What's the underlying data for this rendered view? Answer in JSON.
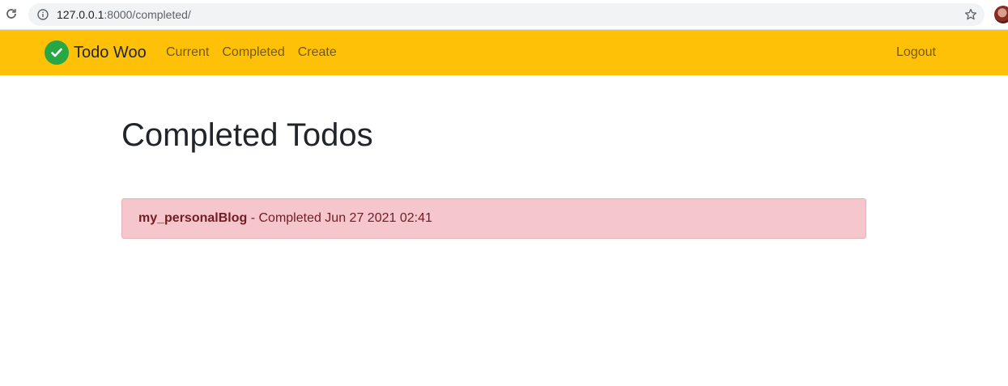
{
  "browser": {
    "url_host": "127.0.0.1",
    "url_rest": ":8000/completed/",
    "icons": {
      "reload": "reload-icon",
      "info": "info-icon",
      "bookmark": "star-icon"
    }
  },
  "navbar": {
    "background": "#ffc107",
    "brand": {
      "name": "Todo Woo",
      "logo_color": "#28a745",
      "logo_icon": "check-circle-icon"
    },
    "links": [
      {
        "label": "Current"
      },
      {
        "label": "Completed"
      },
      {
        "label": "Create"
      }
    ],
    "logout_label": "Logout"
  },
  "main": {
    "title": "Completed Todos",
    "todos": [
      {
        "title": "my_personalBlog",
        "status": " - Completed Jun 27 2021 02:41",
        "background": "#f5c6cb",
        "text_color": "#721c24"
      }
    ]
  }
}
